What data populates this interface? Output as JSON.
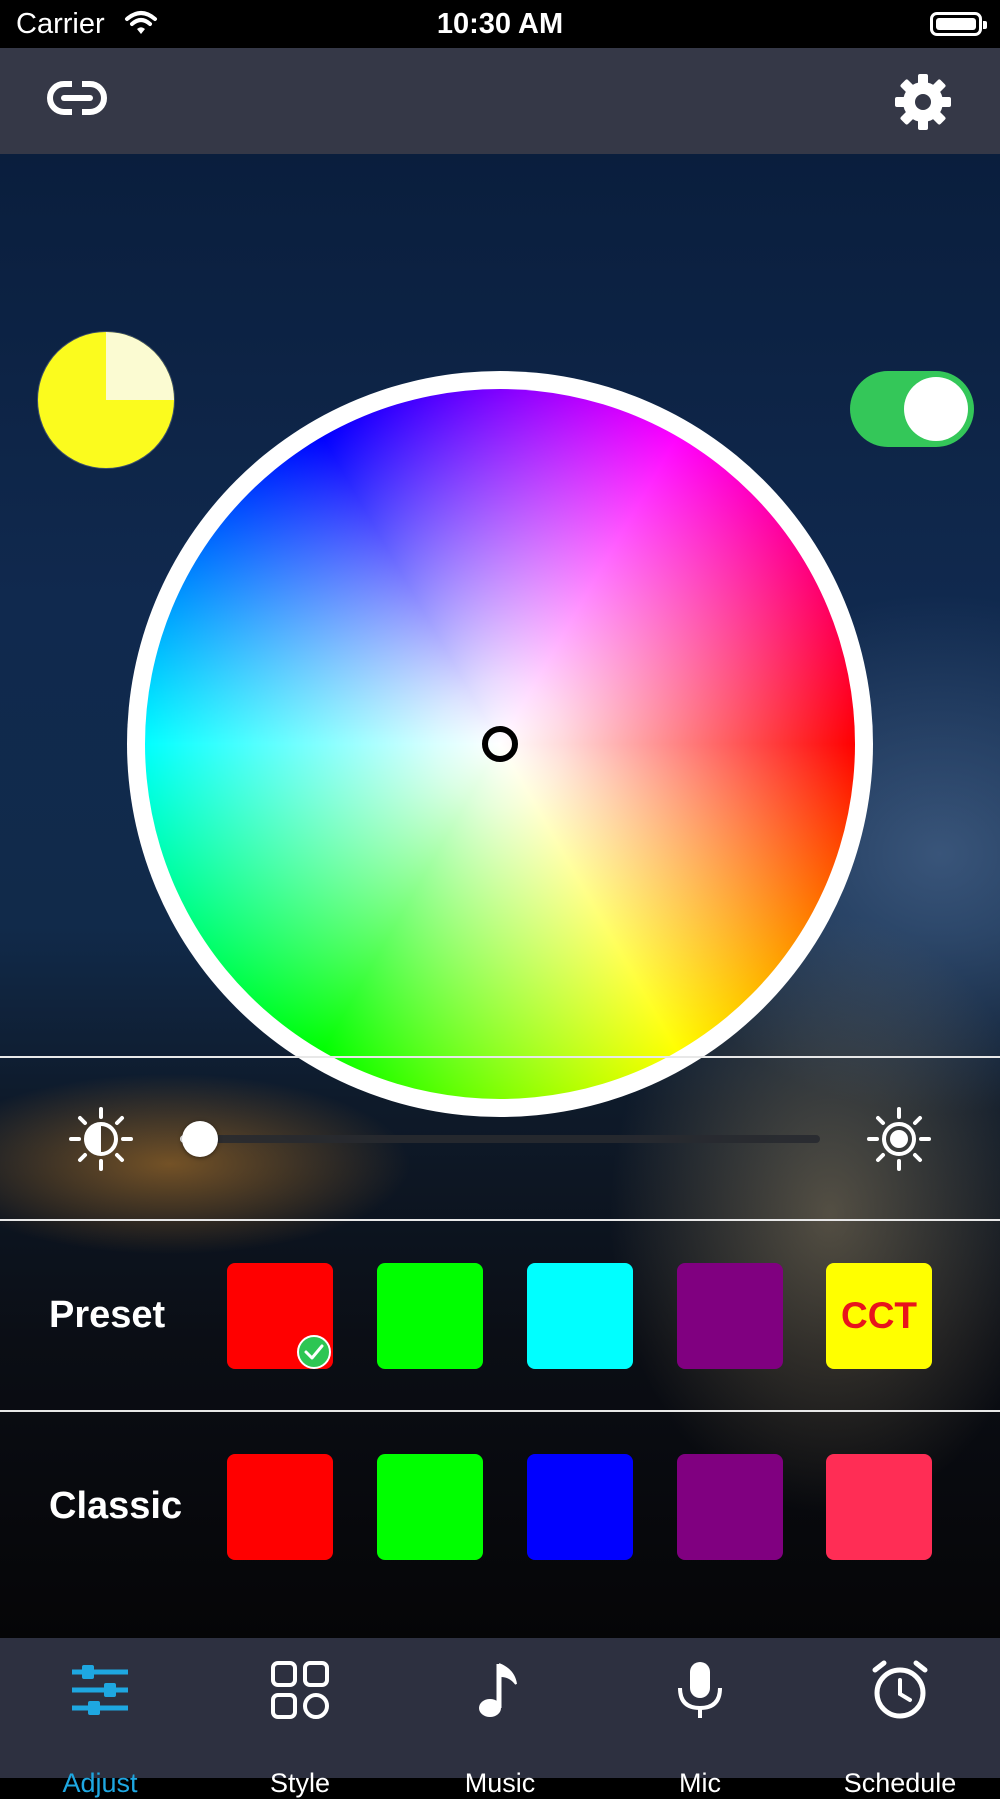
{
  "status_bar": {
    "carrier": "Carrier",
    "time": "10:30 AM"
  },
  "nav": {
    "left_icon": "link-icon",
    "right_icon": "gear-icon"
  },
  "power": {
    "on": true
  },
  "color_wheel": {
    "selected_color": "#ffffff",
    "preview_color": "#fbfb1e"
  },
  "brightness": {
    "value_percent": 3,
    "low_icon": "brightness-low-icon",
    "high_icon": "brightness-high-icon"
  },
  "preset": {
    "label": "Preset",
    "swatches": [
      {
        "color": "#ff0000",
        "selected": true
      },
      {
        "color": "#00ff00",
        "selected": false
      },
      {
        "color": "#00ffff",
        "selected": false
      },
      {
        "color": "#800080",
        "selected": false
      },
      {
        "color": "#ffff00",
        "text": "CCT",
        "text_color": "#e8141c",
        "selected": false
      }
    ]
  },
  "classic": {
    "label": "Classic",
    "swatches": [
      {
        "color": "#ff0000"
      },
      {
        "color": "#00ff00"
      },
      {
        "color": "#0000ff"
      },
      {
        "color": "#800080"
      },
      {
        "color": "#ff2d55"
      }
    ]
  },
  "tabs": [
    {
      "label": "Adjust",
      "icon": "sliders-icon",
      "active": true
    },
    {
      "label": "Style",
      "icon": "grid-icon",
      "active": false
    },
    {
      "label": "Music",
      "icon": "music-note-icon",
      "active": false
    },
    {
      "label": "Mic",
      "icon": "microphone-icon",
      "active": false
    },
    {
      "label": "Schedule",
      "icon": "alarm-clock-icon",
      "active": false
    }
  ],
  "colors": {
    "accent": "#1ea7e1",
    "toggle_on": "#34c759",
    "nav_bg": "#353847",
    "tabbar_bg": "#2d3040"
  }
}
